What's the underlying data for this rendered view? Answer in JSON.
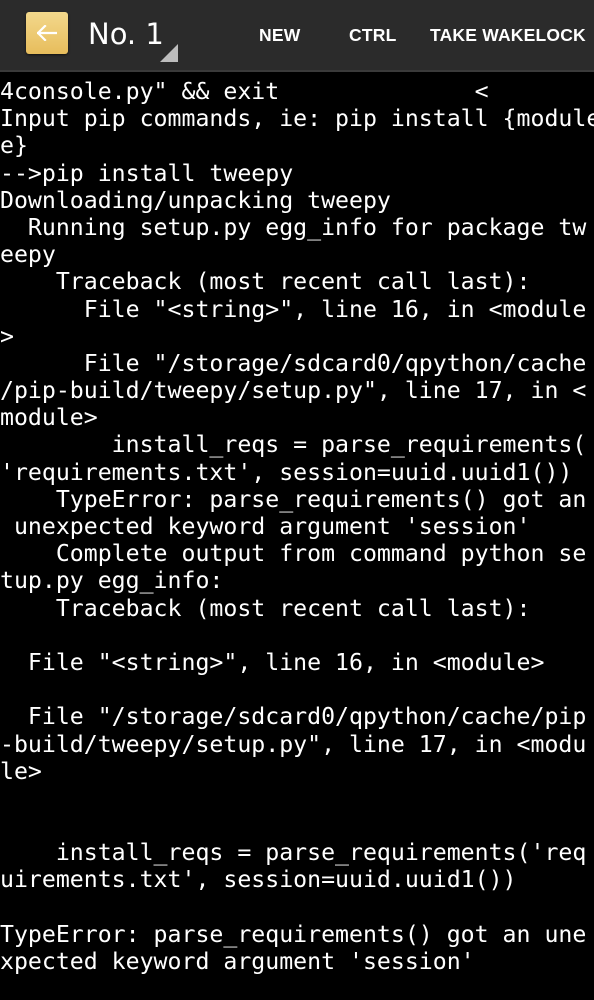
{
  "actionbar": {
    "title": "No. 1",
    "icon": "back-arrow-icon",
    "icon_color": "#e9c26a",
    "buttons": {
      "new": "NEW",
      "ctrl": "CTRL",
      "wakelock": "TAKE WAKELOCK"
    }
  },
  "terminal": {
    "background": "#000000",
    "foreground": "#ffffff",
    "lines": [
      "4console.py\" && exit              <",
      "Input pip commands, ie: pip install {module",
      "e}",
      "-->pip install tweepy",
      "Downloading/unpacking tweepy",
      "  Running setup.py egg_info for package tw",
      "eepy",
      "    Traceback (most recent call last):",
      "      File \"<string>\", line 16, in <module",
      ">",
      "      File \"/storage/sdcard0/qpython/cache",
      "/pip-build/tweepy/setup.py\", line 17, in <",
      "module>",
      "        install_reqs = parse_requirements(",
      "'requirements.txt', session=uuid.uuid1())",
      "    TypeError: parse_requirements() got an",
      " unexpected keyword argument 'session'",
      "    Complete output from command python se",
      "tup.py egg_info:",
      "    Traceback (most recent call last):",
      "",
      "  File \"<string>\", line 16, in <module>",
      "",
      "  File \"/storage/sdcard0/qpython/cache/pip",
      "-build/tweepy/setup.py\", line 17, in <modu",
      "le>",
      "",
      "",
      "    install_reqs = parse_requirements('req",
      "uirements.txt', session=uuid.uuid1())",
      "",
      "TypeError: parse_requirements() got an une",
      "xpected keyword argument 'session'",
      "",
      "----------------------------------------"
    ]
  }
}
